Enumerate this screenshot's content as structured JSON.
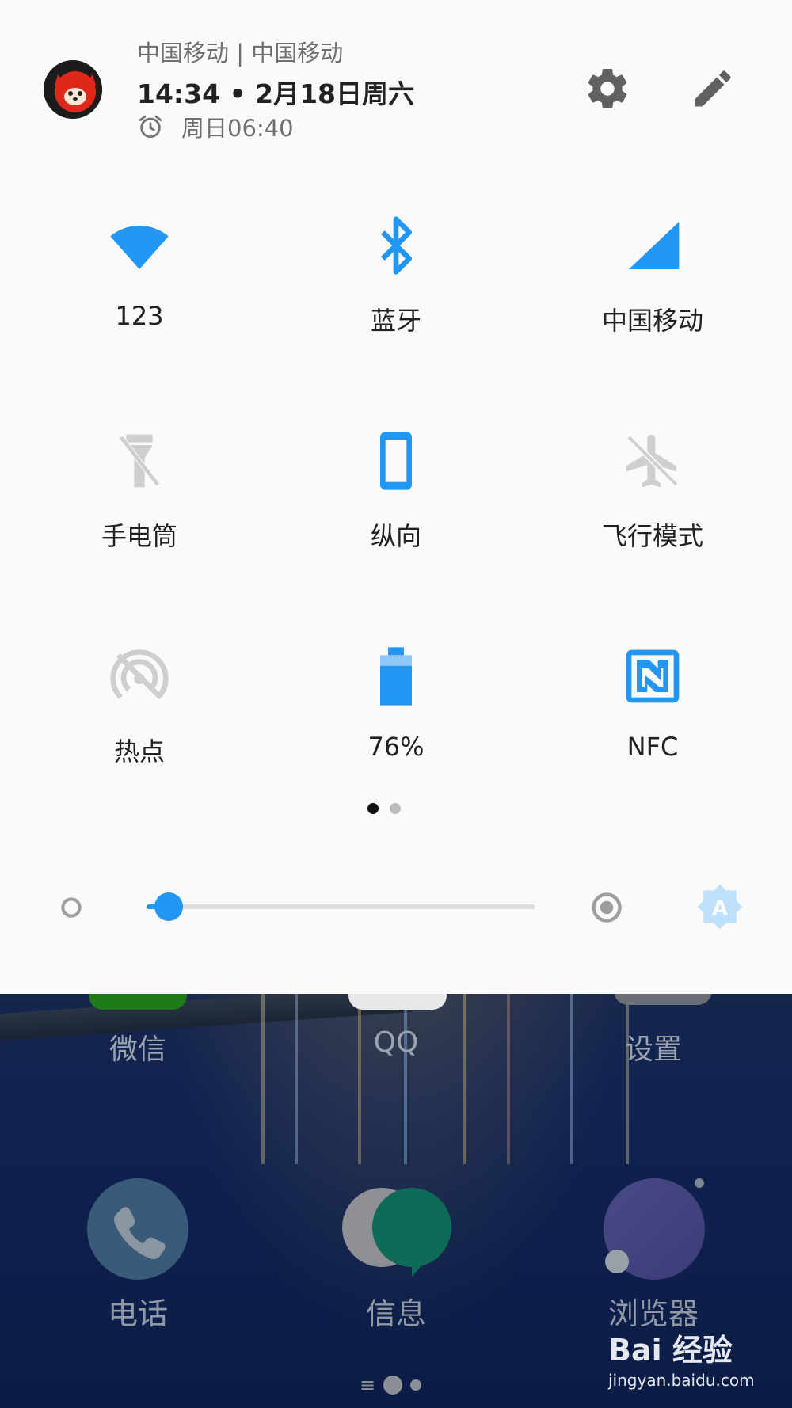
{
  "header": {
    "carrier": "中国移动 | 中国移动",
    "time_date": "14:34 • 2月18日周六",
    "alarm": "周日06:40"
  },
  "tiles": [
    {
      "label": "123",
      "icon": "wifi-icon",
      "active": true
    },
    {
      "label": "蓝牙",
      "icon": "bluetooth-icon",
      "active": true
    },
    {
      "label": "中国移动",
      "icon": "cellular-signal-icon",
      "active": true
    },
    {
      "label": "手电筒",
      "icon": "flashlight-icon",
      "active": false
    },
    {
      "label": "纵向",
      "icon": "portrait-rotation-icon",
      "active": true
    },
    {
      "label": "飞行模式",
      "icon": "airplane-icon",
      "active": false
    },
    {
      "label": "热点",
      "icon": "hotspot-icon",
      "active": false
    },
    {
      "label": "76%",
      "icon": "battery-icon",
      "active": true
    },
    {
      "label": "NFC",
      "icon": "nfc-icon",
      "active": true
    }
  ],
  "pagination": {
    "current": 1,
    "total": 2
  },
  "brightness": {
    "level": 0.04,
    "auto": true
  },
  "home_apps": [
    "微信",
    "QQ",
    "设置"
  ],
  "dock_apps": [
    "电话",
    "信息",
    "浏览器"
  ],
  "watermark": {
    "logo": "Bai 经验",
    "site": "jingyan.baidu.com"
  },
  "colors": {
    "accent": "#2196f3",
    "inactive": "#cfcfcf",
    "panel": "#fafafa"
  }
}
